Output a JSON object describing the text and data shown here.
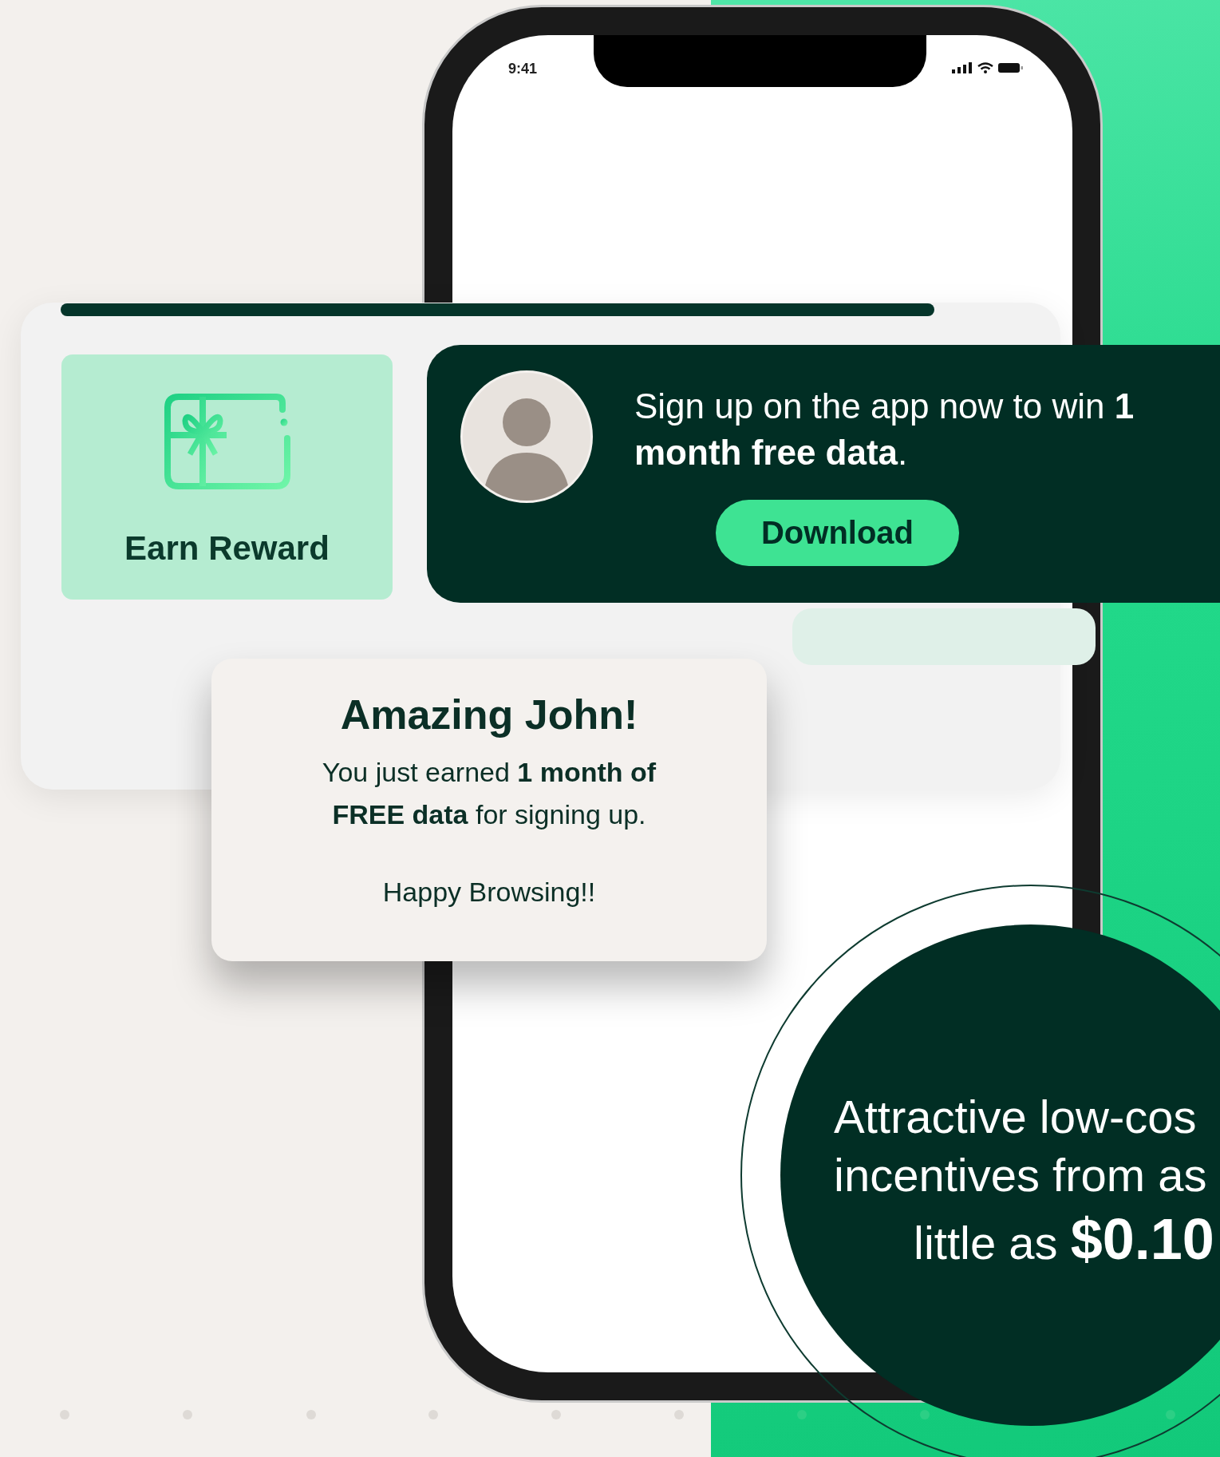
{
  "phone": {
    "status_time": "9:41"
  },
  "reward_tile": {
    "label": "Earn Reward"
  },
  "promo_banner": {
    "message": "Sign up on the app now to win **1 month free data**.",
    "button": "Download"
  },
  "popup": {
    "title": "Amazing John!",
    "message": "You just earned **1 month of FREE data** for signing up.",
    "footer": "Happy Browsing!!"
  },
  "price_badge": {
    "lines": [
      "Attractive low-cos",
      "incentives from as",
      "little as **$0.10**"
    ]
  }
}
